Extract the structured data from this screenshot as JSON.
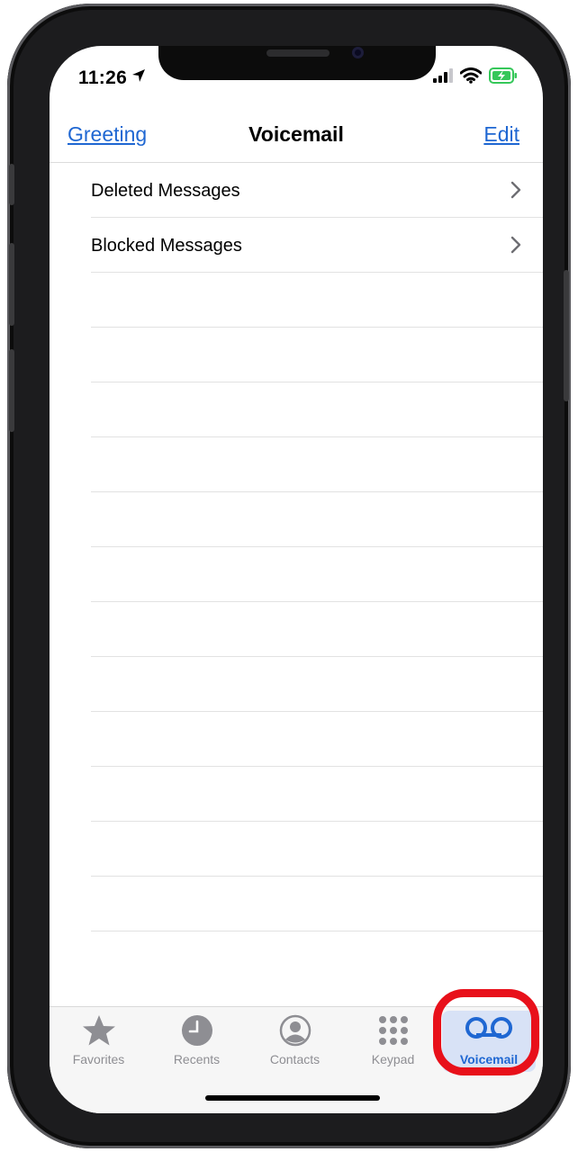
{
  "status": {
    "time": "11:26"
  },
  "nav": {
    "left_label": "Greeting",
    "title": "Voicemail",
    "right_label": "Edit"
  },
  "list": {
    "items": [
      {
        "label": "Deleted Messages"
      },
      {
        "label": "Blocked Messages"
      }
    ]
  },
  "tabs": [
    {
      "label": "Favorites",
      "icon": "star-icon"
    },
    {
      "label": "Recents",
      "icon": "clock-icon"
    },
    {
      "label": "Contacts",
      "icon": "person-circle-icon"
    },
    {
      "label": "Keypad",
      "icon": "keypad-icon"
    },
    {
      "label": "Voicemail",
      "icon": "voicemail-icon",
      "active": true
    }
  ],
  "colors": {
    "accent": "#1f67d2",
    "highlight": "#e8101a",
    "tab_inactive": "#8e8e93",
    "battery": "#35c759"
  }
}
